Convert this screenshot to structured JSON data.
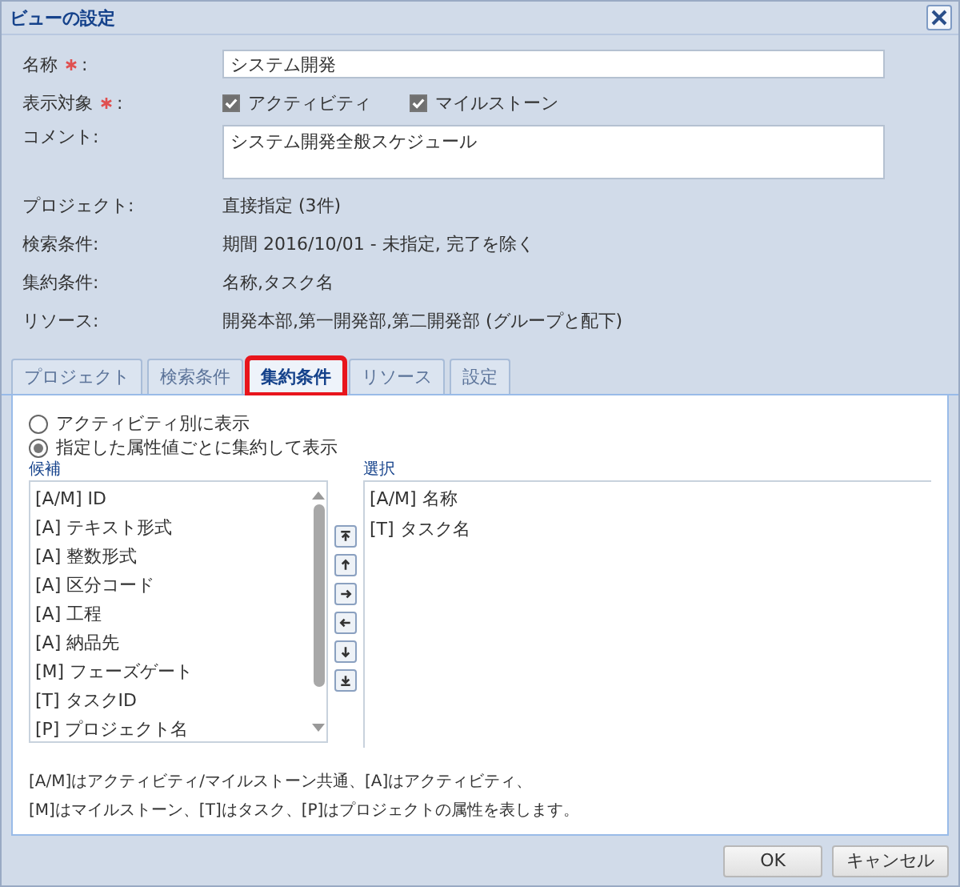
{
  "window": {
    "title": "ビューの設定"
  },
  "form": {
    "name": {
      "label": "名称",
      "required": true,
      "label_end": ":",
      "value": "システム開発"
    },
    "targets": {
      "label": "表示対象",
      "required": true,
      "label_end": ":",
      "options": [
        {
          "label": "アクティビティ",
          "checked": true
        },
        {
          "label": "マイルストーン",
          "checked": true
        }
      ]
    },
    "comment": {
      "label": "コメント:",
      "value": "システム開発全般スケジュール"
    },
    "info": [
      {
        "label": "プロジェクト:",
        "value": "直接指定 (3件)"
      },
      {
        "label": "検索条件:",
        "value": "期間 2016/10/01 - 未指定, 完了を除く"
      },
      {
        "label": "集約条件:",
        "value": "名称,タスク名"
      },
      {
        "label": "リソース:",
        "value": "開発本部,第一開発部,第二開発部 (グループと配下)"
      }
    ]
  },
  "tabs": [
    {
      "label": "プロジェクト",
      "selected": false
    },
    {
      "label": "検索条件",
      "selected": false
    },
    {
      "label": "集約条件",
      "selected": true
    },
    {
      "label": "リソース",
      "selected": false
    },
    {
      "label": "設定",
      "selected": false
    }
  ],
  "modes": [
    {
      "label": "アクティビティ別に表示",
      "selected": false
    },
    {
      "label": "指定した属性値ごとに集約して表示",
      "selected": true
    }
  ],
  "candidates": {
    "title": "候補",
    "items": [
      "[A/M] ID",
      "[A] テキスト形式",
      "[A] 整数形式",
      "[A] 区分コード",
      "[A] 工程",
      "[A] 納品先",
      "[M] フェーズゲート",
      "[T] タスクID",
      "[P] プロジェクト名"
    ]
  },
  "move_buttons": [
    {
      "kind": "top"
    },
    {
      "kind": "up"
    },
    {
      "kind": "right"
    },
    {
      "kind": "left"
    },
    {
      "kind": "down"
    },
    {
      "kind": "bottom"
    }
  ],
  "selection": {
    "title": "選択",
    "items": [
      "[A/M] 名称",
      "[T] タスク名"
    ]
  },
  "note": [
    "[A/M]はアクティビティ/マイルストーン共通、[A]はアクティビティ、",
    "[M]はマイルストーン、[T]はタスク、[P]はプロジェクトの属性を表します。"
  ],
  "buttons": [
    "OK",
    "キャンセル"
  ]
}
